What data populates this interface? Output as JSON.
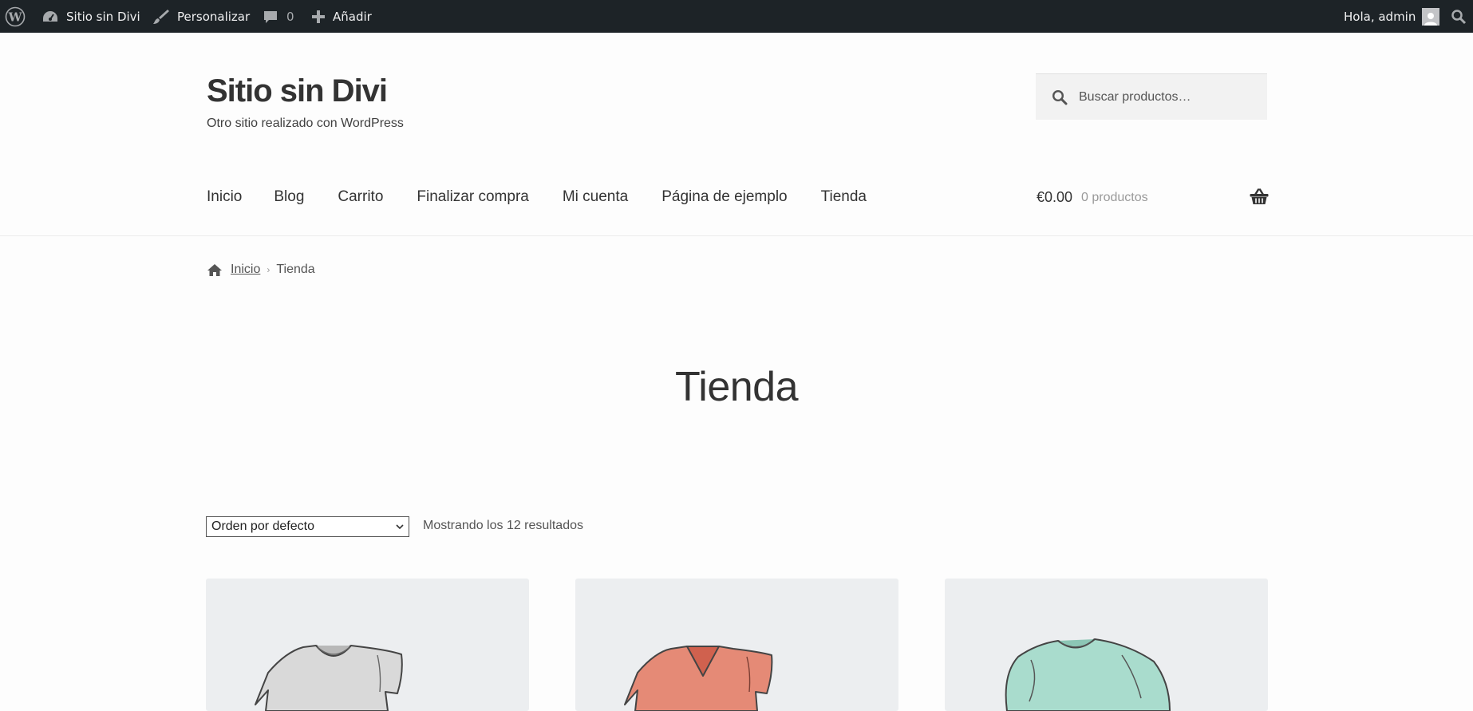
{
  "adminbar": {
    "site_name": "Sitio sin Divi",
    "customize": "Personalizar",
    "comments_count": "0",
    "add_new": "Añadir",
    "greeting": "Hola, admin"
  },
  "header": {
    "site_title": "Sitio sin Divi",
    "site_description": "Otro sitio realizado con WordPress",
    "search_placeholder": "Buscar productos…"
  },
  "nav": {
    "items": [
      "Inicio",
      "Blog",
      "Carrito",
      "Finalizar compra",
      "Mi cuenta",
      "Página de ejemplo",
      "Tienda"
    ]
  },
  "cart": {
    "amount": "€0.00",
    "count": "0 productos"
  },
  "breadcrumb": {
    "home": "Inicio",
    "current": "Tienda"
  },
  "page": {
    "title": "Tienda"
  },
  "shop": {
    "orderby_selected": "Orden por defecto",
    "result_count": "Mostrando los 12 resultados"
  },
  "colors": {
    "adminbar_bg": "#1d2327",
    "product_bg": "#eceef0",
    "tshirt_gray": "#d9d9d9",
    "tshirt_red": "#e58a76",
    "sweater_mint": "#a9dccd"
  }
}
